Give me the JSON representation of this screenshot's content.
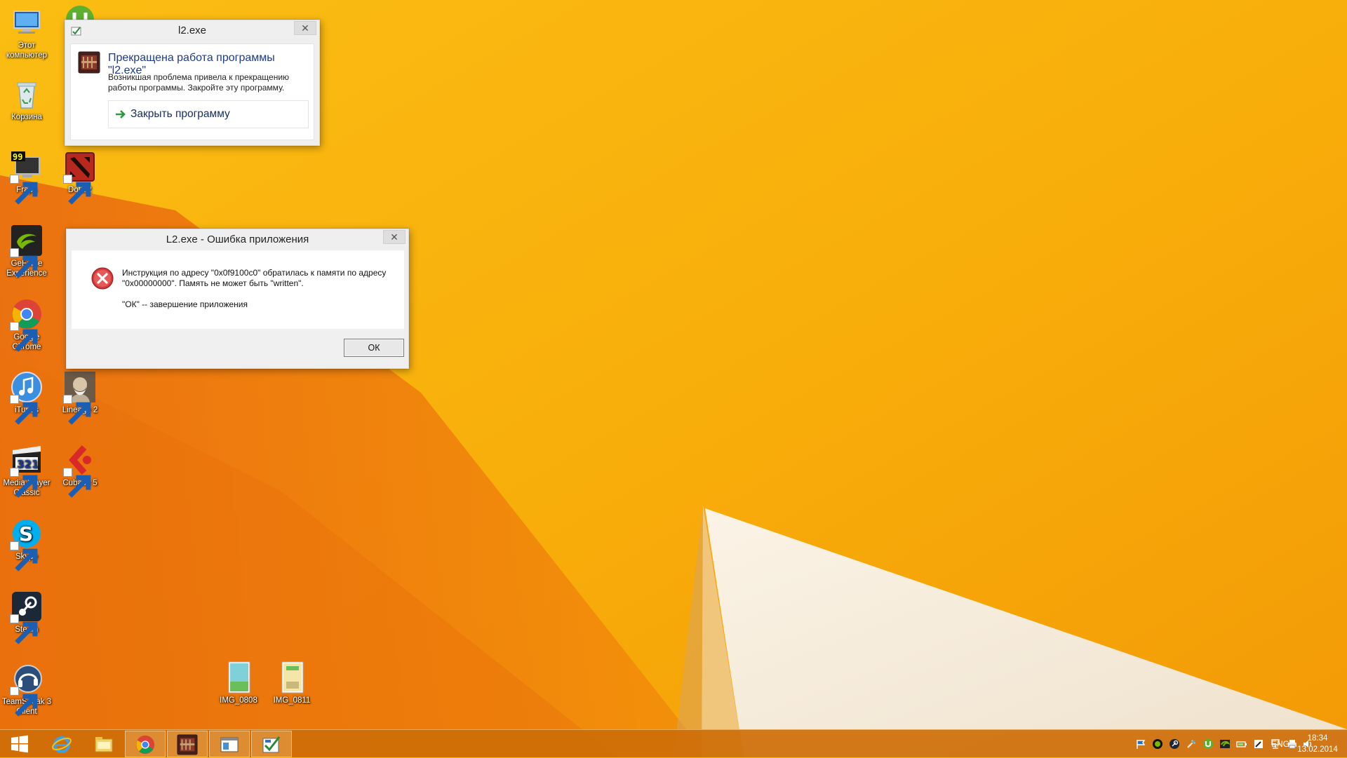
{
  "desktop": {
    "icons": [
      {
        "label": "Этот компьютер",
        "icon": "computer-icon"
      },
      {
        "label": "Корзина",
        "icon": "recycle-bin-icon"
      },
      {
        "label": "Fraps",
        "icon": "fraps-icon"
      },
      {
        "label": "Dota 2",
        "icon": "dota-icon"
      },
      {
        "label": "GeForce Experience",
        "icon": "geforce-icon"
      },
      {
        "label": "Google Chrome",
        "icon": "chrome-icon"
      },
      {
        "label": "iTunes",
        "icon": "itunes-icon"
      },
      {
        "label": "Lineage 2",
        "icon": "lineage-icon"
      },
      {
        "label": "Media Player Classic",
        "icon": "media-player-icon"
      },
      {
        "label": "Cubase 5",
        "icon": "cubase-icon"
      },
      {
        "label": "Skype",
        "icon": "skype-icon"
      },
      {
        "label": "Steam",
        "icon": "steam-icon"
      },
      {
        "label": "TeamSpeak 3 Client",
        "icon": "teamspeak-icon"
      },
      {
        "label": "IMG_0808",
        "icon": "image-file-icon"
      },
      {
        "label": "IMG_0811",
        "icon": "image-file-icon"
      }
    ]
  },
  "crash_dialog": {
    "title": "l2.exe",
    "heading": "Прекращена работа программы \"l2.exe\"",
    "description": "Возникшая проблема привела к прекращению работы программы. Закройте эту программу.",
    "close_program_label": "Закрыть программу",
    "close_symbol": "✕"
  },
  "error_dialog": {
    "title": "L2.exe - Ошибка приложения",
    "message_line1": "Инструкция по адресу \"0x0f9100c0\" обратилась к памяти по адресу \"0x00000000\". Память не может быть \"written\".",
    "message_line2": "\"ОК\" -- завершение приложения",
    "ok_label": "ОК",
    "close_symbol": "✕"
  },
  "taskbar": {
    "pinned": [
      "windows-start-icon",
      "internet-explorer-icon",
      "file-explorer-icon",
      "chrome-icon",
      "lineage-icon",
      "window-icon",
      "crash-report-icon"
    ],
    "active_index": 3,
    "tray_icons": [
      "flag-icon",
      "nvidia-tray-icon",
      "steam-tray-icon",
      "tool-icon",
      "utorrent-icon",
      "nvidia-icon",
      "battery-icon",
      "pen-icon",
      "network-icon",
      "printer-icon",
      "volume-icon"
    ],
    "language": "ENG",
    "time": "18:34",
    "date": "13.02.2014"
  },
  "colors": {
    "wallpaper": "#f8b40c",
    "taskbar": "#ce6e08",
    "dialog_heading": "#1e3a8a"
  }
}
